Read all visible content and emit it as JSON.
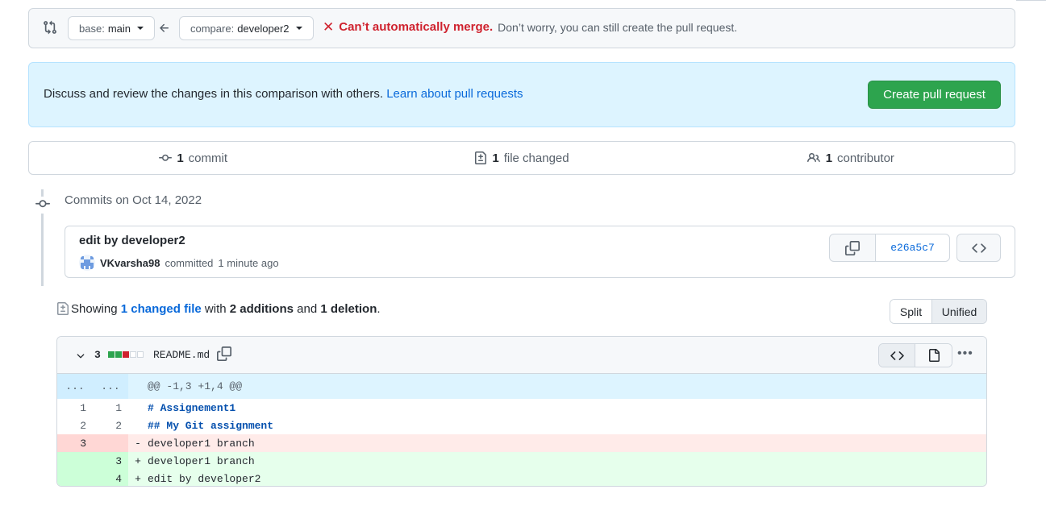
{
  "range": {
    "base_label": "base:",
    "base_value": "main",
    "compare_label": "compare:",
    "compare_value": "developer2",
    "merge_status": "Can’t automatically merge.",
    "merge_note": "Don’t worry, you can still create the pull request."
  },
  "discuss": {
    "text": "Discuss and review the changes in this comparison with others.",
    "link": "Learn about pull requests",
    "create_button": "Create pull request"
  },
  "summary": {
    "commits_count": "1",
    "commits_label": "commit",
    "files_count": "1",
    "files_label": "file changed",
    "contributors_count": "1",
    "contributors_label": "contributor"
  },
  "commits": {
    "heading": "Commits on Oct 14, 2022",
    "items": [
      {
        "title": "edit by developer2",
        "author": "VKvarsha98",
        "action": "committed",
        "time": "1 minute ago",
        "sha": "e26a5c7"
      }
    ]
  },
  "toc": {
    "showing": "Showing",
    "changed_files": "1 changed file",
    "with": "with",
    "additions": "2 additions",
    "and": "and",
    "deletions": "1 deletion",
    "period": ".",
    "split": "Split",
    "unified": "Unified"
  },
  "file": {
    "change_count": "3",
    "name": "README.md",
    "hunk_left": "...",
    "hunk_right": "...",
    "hunk_header": "@@ -1,3 +1,4 @@",
    "colors": {
      "add": "#2da44e",
      "del": "#cf222e",
      "neutral": "#d0d7de"
    },
    "lines": [
      {
        "old": "1",
        "new": "1",
        "marker": "",
        "code": "# Assignement1"
      },
      {
        "old": "2",
        "new": "2",
        "marker": "",
        "code": "## My Git assignment"
      },
      {
        "old": "3",
        "new": "",
        "marker": "-",
        "code": "developer1 branch"
      },
      {
        "old": "",
        "new": "3",
        "marker": "+",
        "code": "developer1 branch"
      },
      {
        "old": "",
        "new": "4",
        "marker": "+",
        "code": "edit by developer2"
      }
    ]
  }
}
